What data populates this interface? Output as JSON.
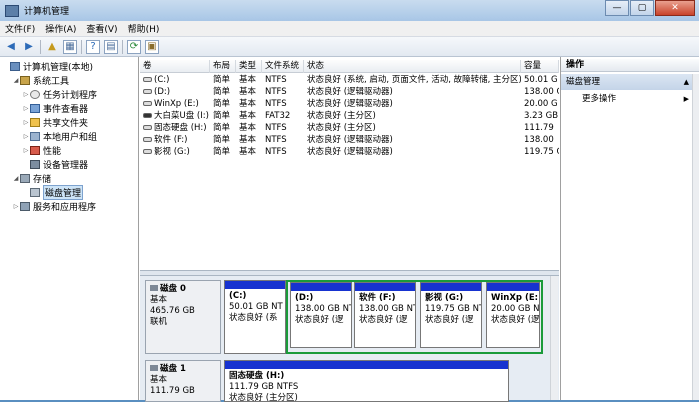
{
  "window": {
    "title": "计算机管理",
    "min": "—",
    "max": "▢",
    "close": "✕"
  },
  "menu": [
    "文件(F)",
    "操作(A)",
    "查看(V)",
    "帮助(H)"
  ],
  "tree": {
    "root": "计算机管理(本地)",
    "system_tools": "系统工具",
    "task_scheduler": "任务计划程序",
    "event_viewer": "事件查看器",
    "shared_folders": "共享文件夹",
    "local_users": "本地用户和组",
    "performance": "性能",
    "device_manager": "设备管理器",
    "storage": "存储",
    "disk_management": "磁盘管理",
    "services_apps": "服务和应用程序"
  },
  "columns": [
    "卷",
    "布局",
    "类型",
    "文件系统",
    "状态",
    "容量"
  ],
  "volumes": [
    {
      "name": "(C:)",
      "layout": "简单",
      "type": "基本",
      "fs": "NTFS",
      "status": "状态良好 (系统, 启动, 页面文件, 活动, 故障转储, 主分区)",
      "cap": "50.01 G",
      "icon": "drive-icon"
    },
    {
      "name": "(D:)",
      "layout": "简单",
      "type": "基本",
      "fs": "NTFS",
      "status": "状态良好 (逻辑驱动器)",
      "cap": "138.00 G",
      "icon": "drive-icon"
    },
    {
      "name": "WinXp (E:)",
      "layout": "简单",
      "type": "基本",
      "fs": "NTFS",
      "status": "状态良好 (逻辑驱动器)",
      "cap": "20.00 G",
      "icon": "drive-icon"
    },
    {
      "name": "大白菜U盘 (I:)",
      "layout": "简单",
      "type": "基本",
      "fs": "FAT32",
      "status": "状态良好 (主分区)",
      "cap": "3.23 GB",
      "icon": "usb-drive-icon"
    },
    {
      "name": "固态硬盘 (H:)",
      "layout": "简单",
      "type": "基本",
      "fs": "NTFS",
      "status": "状态良好 (主分区)",
      "cap": "111.79",
      "icon": "drive-icon"
    },
    {
      "name": "软件 (F:)",
      "layout": "简单",
      "type": "基本",
      "fs": "NTFS",
      "status": "状态良好 (逻辑驱动器)",
      "cap": "138.00",
      "icon": "drive-icon"
    },
    {
      "name": "影视 (G:)",
      "layout": "简单",
      "type": "基本",
      "fs": "NTFS",
      "status": "状态良好 (逻辑驱动器)",
      "cap": "119.75 G",
      "icon": "drive-icon"
    }
  ],
  "disk0": {
    "name": "磁盘 0",
    "type": "基本",
    "size": "465.76 GB",
    "state": "联机",
    "parts": [
      {
        "label": "(C:)",
        "size": "50.01 GB NT",
        "status": "状态良好 (系"
      },
      {
        "label": "(D:)",
        "size": "138.00 GB NT",
        "status": "状态良好 (逻"
      },
      {
        "label": "软件 (F:)",
        "size": "138.00 GB NT",
        "status": "状态良好 (逻"
      },
      {
        "label": "影视 (G:)",
        "size": "119.75 GB NT",
        "status": "状态良好 (逻"
      },
      {
        "label": "WinXp (E:",
        "size": "20.00 GB NT",
        "status": "状态良好 (逻"
      }
    ]
  },
  "disk1": {
    "name": "磁盘 1",
    "type": "基本",
    "size": "111.79 GB",
    "parts": [
      {
        "label": "固态硬盘 (H:)",
        "size": "111.79 GB NTFS",
        "status": "状态良好 (主分区)"
      }
    ]
  },
  "actions": {
    "header": "操作",
    "section": "磁盘管理",
    "more": "更多操作"
  },
  "colors": {
    "primary_partition": "#1733d0",
    "extended_partition_border": "#1a9b3a",
    "selection": "#cde4f7"
  }
}
